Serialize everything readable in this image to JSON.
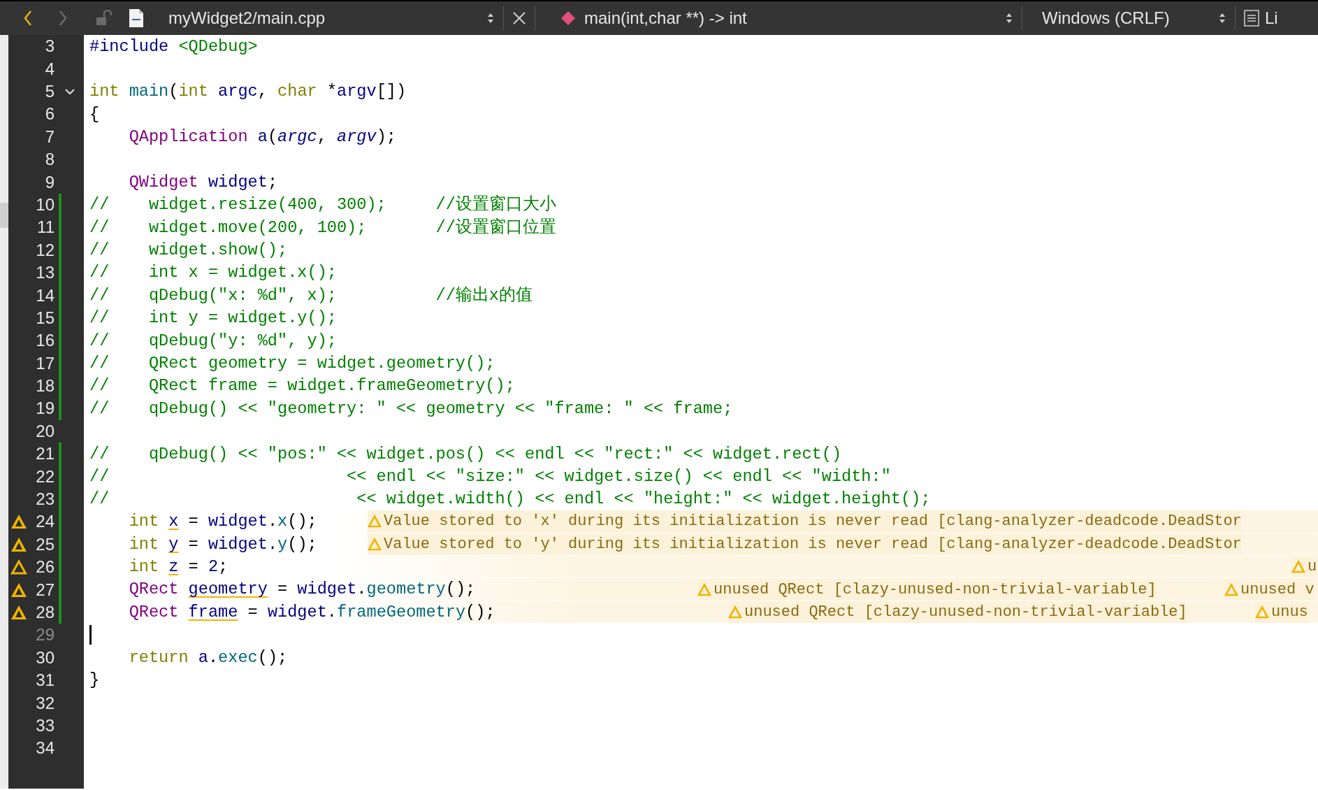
{
  "toolbar": {
    "back_enabled": true,
    "forward_enabled": false,
    "file": "myWidget2/main.cpp",
    "symbol": "main(int,char **) -> int",
    "line_ending": "Windows (CRLF)",
    "cut_label": "Li"
  },
  "lines": [
    {
      "no": "3",
      "changed": false,
      "current": false,
      "tokens": [
        {
          "kind": "pre",
          "text": "#include"
        },
        {
          "kind": "inc",
          "text": " <QDebug>"
        }
      ]
    },
    {
      "no": "4",
      "changed": false,
      "current": false
    },
    {
      "no": "5",
      "changed": false,
      "current": false,
      "fold": {
        "expanded": true
      },
      "tokens": [
        {
          "kind": "kw",
          "text": "int"
        },
        {
          "kind": "fn",
          "text": " main"
        },
        {
          "kind": "plain",
          "text": "("
        },
        {
          "kind": "kw",
          "text": "int"
        },
        {
          "kind": "id",
          "text": " argc"
        },
        {
          "kind": "plain",
          "text": ","
        },
        {
          "kind": "kw",
          "text": " char"
        },
        {
          "kind": "plain",
          "text": " *"
        },
        {
          "kind": "id",
          "text": "argv"
        },
        {
          "kind": "plain",
          "text": "[])"
        }
      ]
    },
    {
      "no": "6",
      "changed": false,
      "current": false,
      "tokens": [
        {
          "kind": "plain",
          "text": "{"
        }
      ]
    },
    {
      "no": "7",
      "changed": false,
      "current": false,
      "tokens": [
        {
          "kind": "type",
          "text": "    QApplication"
        },
        {
          "kind": "id",
          "text": " a"
        },
        {
          "kind": "plain",
          "text": "("
        },
        {
          "kind": "param",
          "text": "argc"
        },
        {
          "kind": "plain",
          "text": ","
        },
        {
          "kind": "param",
          "text": " argv"
        },
        {
          "kind": "plain",
          "text": ");"
        }
      ]
    },
    {
      "no": "8",
      "changed": false,
      "current": false
    },
    {
      "no": "9",
      "changed": false,
      "current": false,
      "tokens": [
        {
          "kind": "type",
          "text": "    QWidget"
        },
        {
          "kind": "id",
          "text": " widget"
        },
        {
          "kind": "plain",
          "text": ";"
        }
      ]
    },
    {
      "no": "10",
      "changed": true,
      "current": false,
      "tokens": [
        {
          "kind": "comment",
          "text": "//    widget.resize(400, 300);     //设置窗口大小"
        }
      ]
    },
    {
      "no": "11",
      "changed": true,
      "current": false,
      "tokens": [
        {
          "kind": "comment",
          "text": "//    widget.move(200, 100);       //设置窗口位置"
        }
      ]
    },
    {
      "no": "12",
      "changed": true,
      "current": false,
      "tokens": [
        {
          "kind": "comment",
          "text": "//    widget.show();"
        }
      ]
    },
    {
      "no": "13",
      "changed": true,
      "current": false,
      "tokens": [
        {
          "kind": "comment",
          "text": "//    int x = widget.x();"
        }
      ]
    },
    {
      "no": "14",
      "changed": true,
      "current": false,
      "tokens": [
        {
          "kind": "comment",
          "text": "//    qDebug(\"x: %d\", x);          //输出x的值"
        }
      ]
    },
    {
      "no": "15",
      "changed": true,
      "current": false,
      "tokens": [
        {
          "kind": "comment",
          "text": "//    int y = widget.y();"
        }
      ]
    },
    {
      "no": "16",
      "changed": true,
      "current": false,
      "tokens": [
        {
          "kind": "comment",
          "text": "//    qDebug(\"y: %d\", y);"
        }
      ]
    },
    {
      "no": "17",
      "changed": true,
      "current": false,
      "tokens": [
        {
          "kind": "comment",
          "text": "//    QRect geometry = widget.geometry();"
        }
      ]
    },
    {
      "no": "18",
      "changed": true,
      "current": false,
      "tokens": [
        {
          "kind": "comment",
          "text": "//    QRect frame = widget.frameGeometry();"
        }
      ]
    },
    {
      "no": "19",
      "changed": true,
      "current": false,
      "tokens": [
        {
          "kind": "comment",
          "text": "//    qDebug() << \"geometry: \" << geometry << \"frame: \" << frame;"
        }
      ]
    },
    {
      "no": "20",
      "changed": false,
      "current": false
    },
    {
      "no": "21",
      "changed": true,
      "current": false,
      "tokens": [
        {
          "kind": "comment",
          "text": "//    qDebug() << \"pos:\" << widget.pos() << endl << \"rect:\" << widget.rect()"
        }
      ]
    },
    {
      "no": "22",
      "changed": true,
      "current": false,
      "tokens": [
        {
          "kind": "comment",
          "text": "//                        << endl << \"size:\" << widget.size() << endl << \"width:\""
        }
      ]
    },
    {
      "no": "23",
      "changed": true,
      "current": false,
      "tokens": [
        {
          "kind": "comment",
          "text": "//                         << widget.width() << endl << \"height:\" << widget.height();"
        }
      ]
    },
    {
      "no": "24",
      "changed": true,
      "current": false,
      "kind": "warning",
      "tokens": [
        {
          "kind": "kw",
          "text": "    int "
        },
        {
          "kind": "warn",
          "text": "x"
        },
        {
          "kind": "plain",
          "text": " ="
        },
        {
          "kind": "id",
          "text": " widget"
        },
        {
          "kind": "plain",
          "text": "."
        },
        {
          "kind": "fn",
          "text": "x"
        },
        {
          "kind": "plain",
          "text": "();"
        }
      ],
      "annotations": [
        "Value stored to 'x' during its initialization is never read [clang-analyzer-deadcode.DeadStor"
      ]
    },
    {
      "no": "25",
      "changed": true,
      "current": false,
      "kind": "warning",
      "tokens": [
        {
          "kind": "kw",
          "text": "    int "
        },
        {
          "kind": "warn",
          "text": "y"
        },
        {
          "kind": "plain",
          "text": " ="
        },
        {
          "kind": "id",
          "text": " widget"
        },
        {
          "kind": "plain",
          "text": "."
        },
        {
          "kind": "fn",
          "text": "y"
        },
        {
          "kind": "plain",
          "text": "();"
        }
      ],
      "annotations": [
        "Value stored to 'y' during its initialization is never read [clang-analyzer-deadcode.DeadStor"
      ]
    },
    {
      "no": "26",
      "changed": true,
      "current": false,
      "kind": "minor-warning",
      "tokens": [
        {
          "kind": "kw",
          "text": "    int "
        },
        {
          "kind": "warn",
          "text": "z"
        },
        {
          "kind": "plain",
          "text": " ="
        },
        {
          "kind": "num",
          "text": " 2"
        },
        {
          "kind": "plain",
          "text": ";"
        }
      ],
      "annotations": [
        "u"
      ]
    },
    {
      "no": "27",
      "changed": true,
      "current": false,
      "kind": "warning",
      "tokens": [
        {
          "kind": "type",
          "text": "    QRect "
        },
        {
          "kind": "warn",
          "text": "geometry"
        },
        {
          "kind": "plain",
          "text": " ="
        },
        {
          "kind": "id",
          "text": " widget"
        },
        {
          "kind": "plain",
          "text": "."
        },
        {
          "kind": "fn",
          "text": "geometry"
        },
        {
          "kind": "plain",
          "text": "();"
        }
      ],
      "annotations": [
        "unused QRect [clazy-unused-non-trivial-variable]",
        "unused v"
      ]
    },
    {
      "no": "28",
      "changed": true,
      "current": false,
      "kind": "warning",
      "tokens": [
        {
          "kind": "type",
          "text": "    QRect "
        },
        {
          "kind": "warn",
          "text": "frame"
        },
        {
          "kind": "plain",
          "text": " ="
        },
        {
          "kind": "id",
          "text": " widget"
        },
        {
          "kind": "plain",
          "text": "."
        },
        {
          "kind": "fn",
          "text": "frameGeometry"
        },
        {
          "kind": "plain",
          "text": "();"
        }
      ],
      "annotations": [
        "unused QRect [clazy-unused-non-trivial-variable]",
        "unus"
      ]
    },
    {
      "no": "29",
      "changed": false,
      "current": true
    },
    {
      "no": "30",
      "changed": false,
      "current": false,
      "tokens": [
        {
          "kind": "kw",
          "text": "    return"
        },
        {
          "kind": "id",
          "text": " a"
        },
        {
          "kind": "plain",
          "text": "."
        },
        {
          "kind": "fn",
          "text": "exec"
        },
        {
          "kind": "plain",
          "text": "();"
        }
      ]
    },
    {
      "no": "31",
      "changed": false,
      "current": false,
      "tokens": [
        {
          "kind": "plain",
          "text": "}"
        }
      ]
    },
    {
      "no": "32",
      "changed": false,
      "current": false
    },
    {
      "no": "33",
      "changed": false,
      "current": false
    },
    {
      "no": "34",
      "changed": false,
      "current": false
    }
  ]
}
